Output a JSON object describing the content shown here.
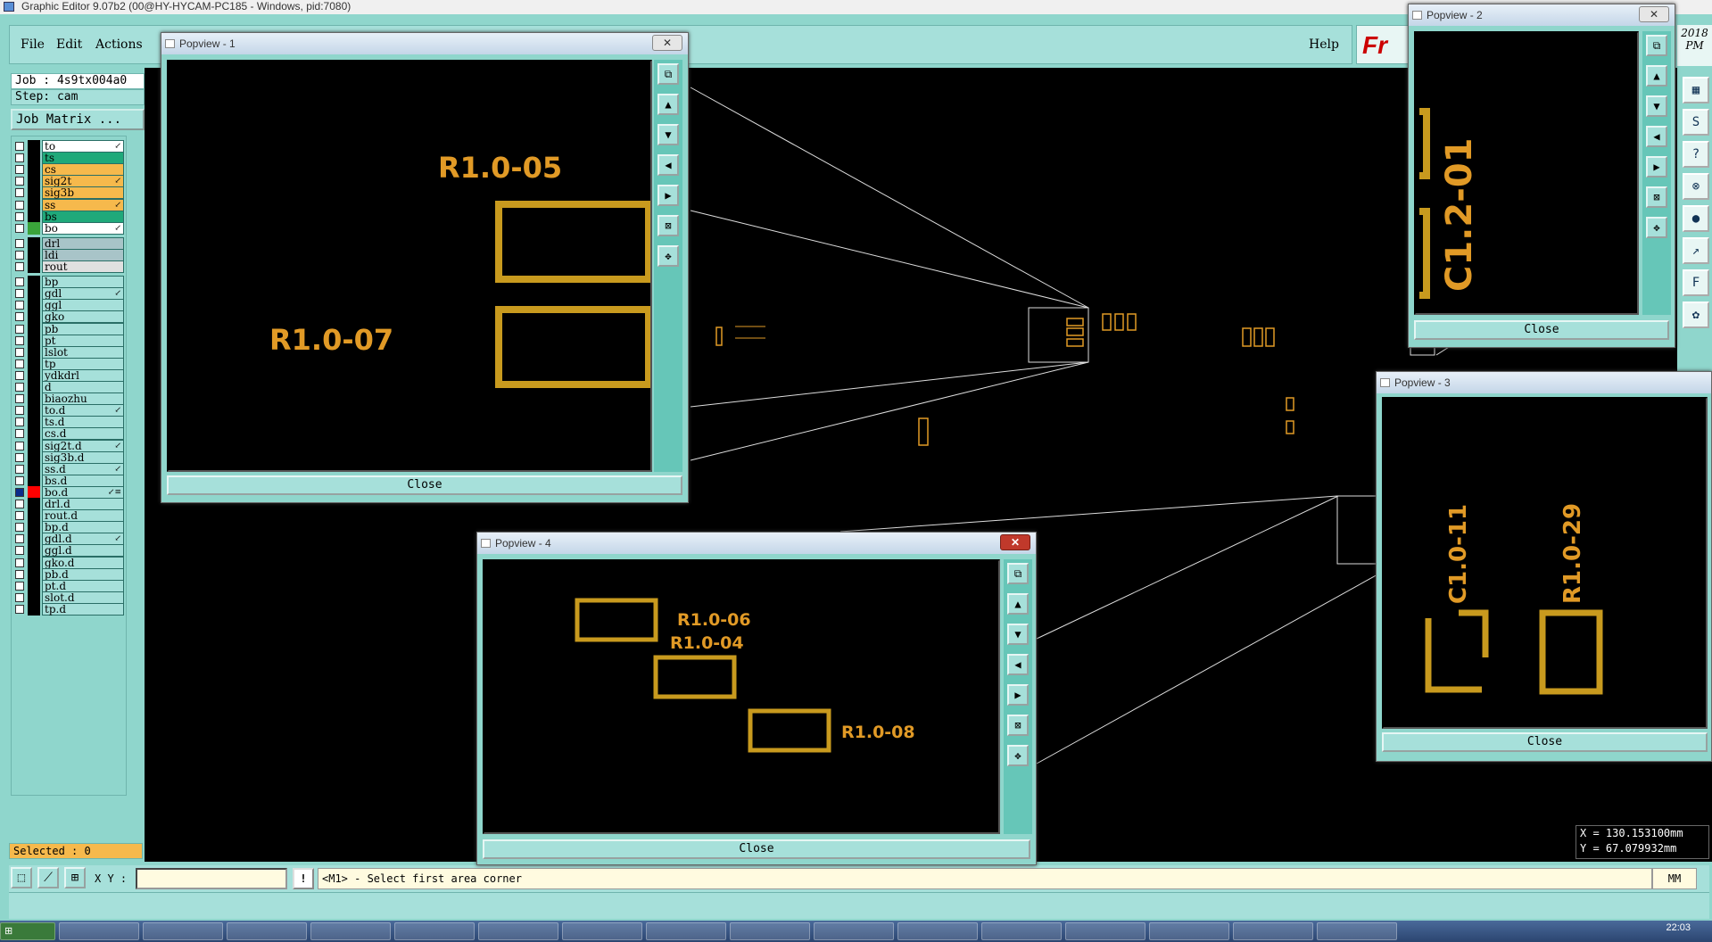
{
  "window": {
    "title": "Graphic Editor 9.07b2 (00@HY-HYCAM-PC185 - Windows, pid:7080)"
  },
  "menubar": {
    "file": "File",
    "edit": "Edit",
    "actions": "Actions",
    "help": "Help",
    "logo_text": "Fr"
  },
  "job": {
    "job_label": "Job : 4s9tx004a0",
    "step_label": "Step: cam",
    "matrix_button": "Job Matrix ..."
  },
  "layers": [
    {
      "name": "to",
      "color": "#ffffff",
      "flag": "↙"
    },
    {
      "name": "ts",
      "color": "#1fa97a",
      "flag": ""
    },
    {
      "name": "cs",
      "color": "#f6b94c",
      "flag": ""
    },
    {
      "name": "sig2t",
      "color": "#f6b94c",
      "flag": "↙"
    },
    {
      "name": "sig3b",
      "color": "#f6b94c",
      "flag": ""
    },
    {
      "name": "ss",
      "color": "#f6b94c",
      "flag": "↙"
    },
    {
      "name": "bs",
      "color": "#1fa97a",
      "flag": ""
    },
    {
      "name": "bo",
      "color": "#ffffff",
      "flag": "↙",
      "swatch": "#3aa33a"
    },
    {
      "name": "drl",
      "color": "#a8c4c8",
      "flag": ""
    },
    {
      "name": "ldi",
      "color": "#a8c4c8",
      "flag": ""
    },
    {
      "name": "rout",
      "color": "#e0e0e0",
      "flag": ""
    },
    {
      "name": "bp",
      "color": "#a6e0da",
      "flag": ""
    },
    {
      "name": "gdl",
      "color": "#a6e0da",
      "flag": "↙"
    },
    {
      "name": "ggl",
      "color": "#a6e0da",
      "flag": ""
    },
    {
      "name": "gko",
      "color": "#a6e0da",
      "flag": ""
    },
    {
      "name": "pb",
      "color": "#a6e0da",
      "flag": ""
    },
    {
      "name": "pt",
      "color": "#a6e0da",
      "flag": ""
    },
    {
      "name": "lslot",
      "color": "#a6e0da",
      "flag": ""
    },
    {
      "name": "tp",
      "color": "#a6e0da",
      "flag": ""
    },
    {
      "name": "ydkdrl",
      "color": "#a6e0da",
      "flag": ""
    },
    {
      "name": "d",
      "color": "#a6e0da",
      "flag": ""
    },
    {
      "name": "biaozhu",
      "color": "#a6e0da",
      "flag": ""
    },
    {
      "name": "to.d",
      "color": "#a6e0da",
      "flag": "↙"
    },
    {
      "name": "ts.d",
      "color": "#a6e0da",
      "flag": ""
    },
    {
      "name": "cs.d",
      "color": "#a6e0da",
      "flag": ""
    },
    {
      "name": "sig2t.d",
      "color": "#a6e0da",
      "flag": "↙"
    },
    {
      "name": "sig3b.d",
      "color": "#a6e0da",
      "flag": ""
    },
    {
      "name": "ss.d",
      "color": "#a6e0da",
      "flag": "↙"
    },
    {
      "name": "bs.d",
      "color": "#a6e0da",
      "flag": ""
    },
    {
      "name": "bo.d",
      "color": "#a6e0da",
      "flag": "↙≡",
      "swatch": "#ff0000",
      "active": true
    },
    {
      "name": "drl.d",
      "color": "#a6e0da",
      "flag": ""
    },
    {
      "name": "rout.d",
      "color": "#a6e0da",
      "flag": ""
    },
    {
      "name": "bp.d",
      "color": "#a6e0da",
      "flag": ""
    },
    {
      "name": "gdl.d",
      "color": "#a6e0da",
      "flag": "↙"
    },
    {
      "name": "ggl.d",
      "color": "#a6e0da",
      "flag": ""
    },
    {
      "name": "gko.d",
      "color": "#a6e0da",
      "flag": ""
    },
    {
      "name": "pb.d",
      "color": "#a6e0da",
      "flag": ""
    },
    {
      "name": "pt.d",
      "color": "#a6e0da",
      "flag": ""
    },
    {
      "name": "slot.d",
      "color": "#a6e0da",
      "flag": ""
    },
    {
      "name": "tp.d",
      "color": "#a6e0da",
      "flag": ""
    }
  ],
  "selected": "Selected : 0",
  "cmd": {
    "xy_label": "X Y :",
    "xy_value": "",
    "bang": "!",
    "prompt": "<M1> - Select first area corner",
    "unit": "MM"
  },
  "coords": {
    "x": "X = 130.153100mm",
    "y": "Y = 67.079932mm"
  },
  "year": {
    "line1": "2018",
    "line2": "PM"
  },
  "popviews": [
    {
      "title": "Popview - 1",
      "close": "Close",
      "labels": [
        "R1.0-05",
        "R1.0-07"
      ]
    },
    {
      "title": "Popview - 2",
      "close": "Close",
      "labels": [
        "C1.2-01"
      ]
    },
    {
      "title": "Popview - 3",
      "close": "Close",
      "labels": [
        "C1.0-11",
        "R1.0-29"
      ]
    },
    {
      "title": "Popview - 4",
      "close": "Close",
      "labels": [
        "R1.0-06",
        "R1.0-04",
        "R1.0-08"
      ]
    }
  ],
  "clock": "22:03",
  "colors": {
    "teal": "#8fd6cc",
    "pad": "#e19a26",
    "canvas": "#000000"
  }
}
